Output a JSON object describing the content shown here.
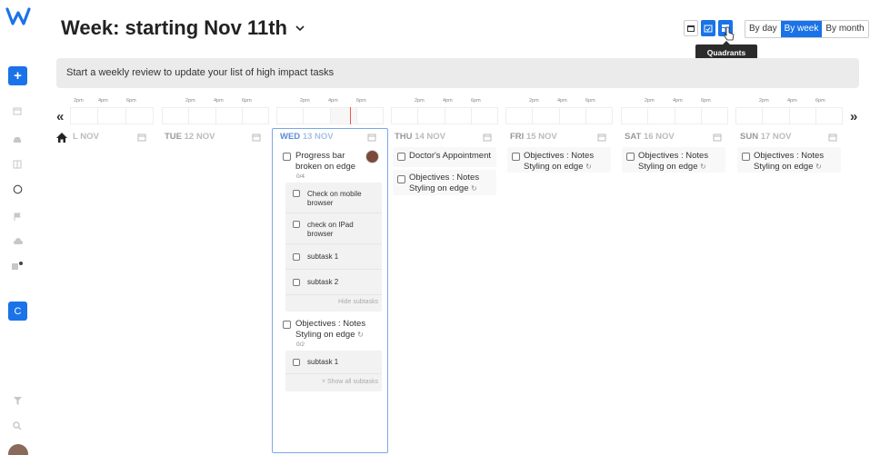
{
  "header": {
    "title": "Week: starting Nov 11th",
    "view_modes": [
      {
        "label": "By day",
        "active": false
      },
      {
        "label": "By week",
        "active": true
      },
      {
        "label": "By month",
        "active": false
      }
    ],
    "tooltip": "Quadrants",
    "accent_color": "#1a73e8"
  },
  "sidebar": {
    "add_label": "+",
    "workspace_label": "C"
  },
  "review_bar": {
    "text": "Start a weekly review to update your list of high impact tasks"
  },
  "timeline": {
    "tick_labels": [
      "2pm",
      "4pm",
      "6pm"
    ],
    "prev": "«",
    "next": "»"
  },
  "days": [
    {
      "dow": "",
      "date": "L NOV"
    },
    {
      "dow": "TUE",
      "date": "12 NOV"
    },
    {
      "dow": "WED",
      "date": "13 NOV"
    },
    {
      "dow": "THU",
      "date": "14 NOV"
    },
    {
      "dow": "FRI",
      "date": "15 NOV"
    },
    {
      "dow": "SAT",
      "date": "16 NOV"
    },
    {
      "dow": "SUN",
      "date": "17 NOV"
    }
  ],
  "tasks": {
    "wed": {
      "t1": {
        "title": "Progress bar broken on edge",
        "count": "0/4",
        "subtasks": [
          "Check on mobile browser",
          "check on IPad browser",
          "subtask 1",
          "subtask 2"
        ],
        "footer": "Hide subtasks"
      },
      "t2": {
        "title": "Objectives : Notes Styling on edge",
        "count": "0/2",
        "subtasks": [
          "subtask 1"
        ],
        "footer": "˅ Show all subtasks"
      }
    },
    "thu": {
      "t1": {
        "title": "Doctor's Appointment"
      },
      "t2": {
        "title": "Objectives : Notes Styling on edge"
      }
    },
    "fri": {
      "t1": {
        "title": "Objectives : Notes Styling on edge"
      }
    },
    "sat": {
      "t1": {
        "title": "Objectives : Notes Styling on edge"
      }
    },
    "sun": {
      "t1": {
        "title": "Objectives : Notes Styling on edge"
      }
    }
  }
}
